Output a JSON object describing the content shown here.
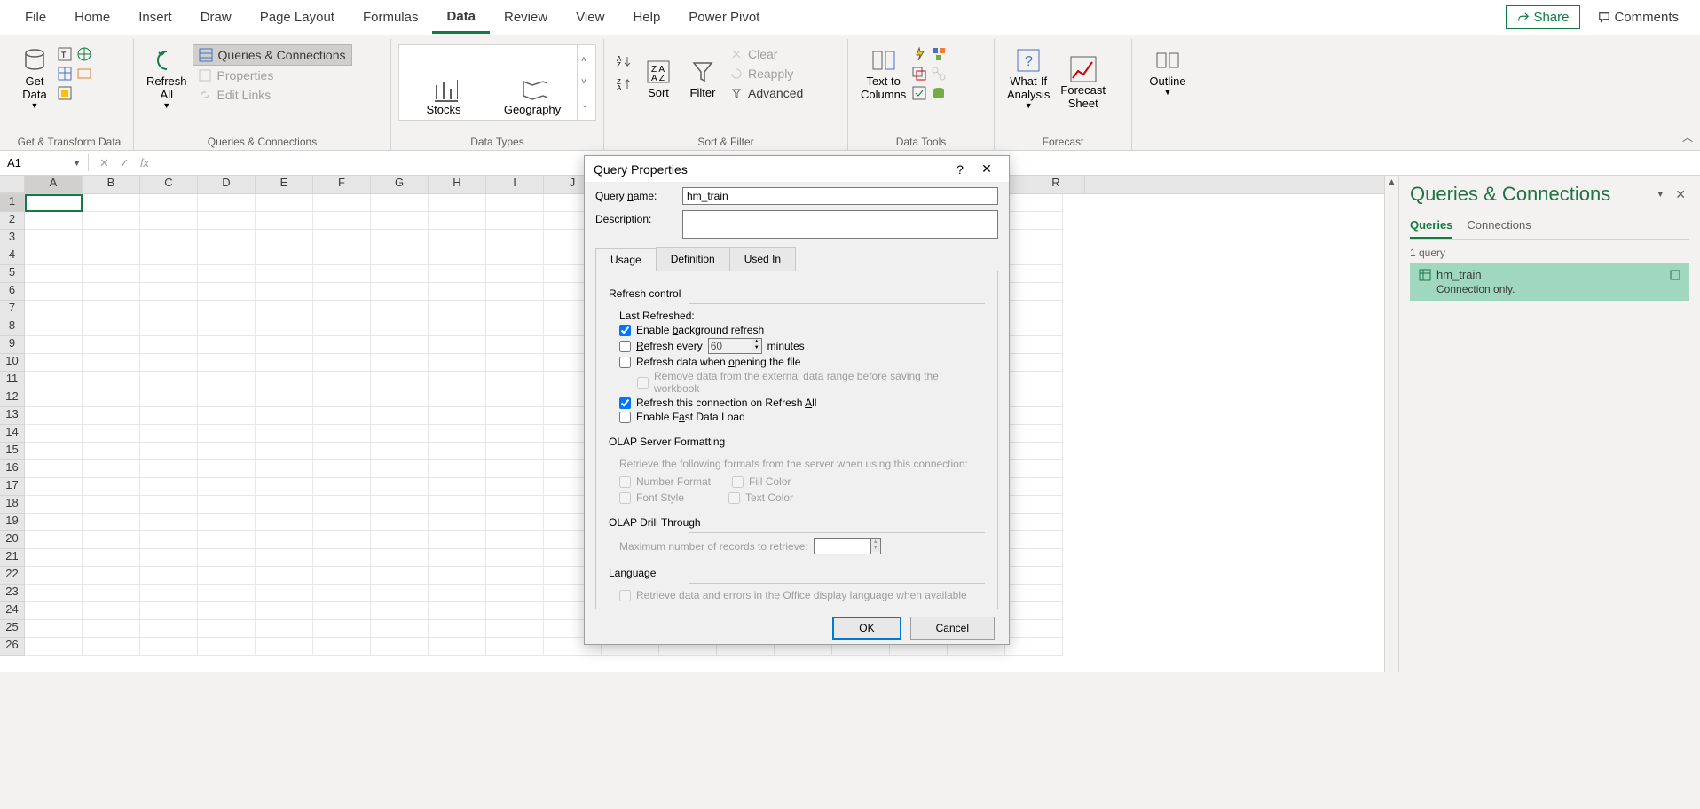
{
  "tabs": {
    "file": "File",
    "home": "Home",
    "insert": "Insert",
    "draw": "Draw",
    "page_layout": "Page Layout",
    "formulas": "Formulas",
    "data": "Data",
    "review": "Review",
    "view": "View",
    "help": "Help",
    "power_pivot": "Power Pivot",
    "share": "Share",
    "comments": "Comments"
  },
  "ribbon": {
    "get_data": "Get\nData",
    "refresh_all": "Refresh\nAll",
    "queries_connections": "Queries & Connections",
    "properties": "Properties",
    "edit_links": "Edit Links",
    "stocks": "Stocks",
    "geography": "Geography",
    "sort": "Sort",
    "filter": "Filter",
    "clear": "Clear",
    "reapply": "Reapply",
    "advanced": "Advanced",
    "text_to_columns": "Text to\nColumns",
    "whatif": "What-If\nAnalysis",
    "forecast_sheet": "Forecast\nSheet",
    "outline": "Outline",
    "groups": {
      "g1": "Get & Transform Data",
      "g2": "Queries & Connections",
      "g3": "Data Types",
      "g4": "Sort & Filter",
      "g5": "Data Tools",
      "g6": "Forecast"
    }
  },
  "name_box": "A1",
  "columns": [
    "A",
    "B",
    "C",
    "D",
    "E",
    "F",
    "G",
    "H",
    "I",
    "J",
    "R"
  ],
  "rows": [
    "1",
    "2",
    "3",
    "4",
    "5",
    "6",
    "7",
    "8",
    "9",
    "10",
    "11",
    "12",
    "13",
    "14",
    "15",
    "16",
    "17",
    "18",
    "19",
    "20",
    "21",
    "22",
    "23",
    "24",
    "25",
    "26"
  ],
  "dialog": {
    "title": "Query Properties",
    "query_name_label": "Query name:",
    "query_name_value": "hm_train",
    "description_label": "Description:",
    "tabs": {
      "usage": "Usage",
      "definition": "Definition",
      "used_in": "Used In"
    },
    "refresh_control": "Refresh control",
    "last_refreshed": "Last Refreshed:",
    "enable_bg": "Enable background refresh",
    "refresh_every": "Refresh every",
    "refresh_minutes_value": "60",
    "minutes": "minutes",
    "refresh_open": "Refresh data when opening the file",
    "remove_data": "Remove data from the external data range before saving the workbook",
    "refresh_all": "Refresh this connection on Refresh All",
    "fast_load": "Enable Fast Data Load",
    "olap_formatting": "OLAP Server Formatting",
    "olap_desc": "Retrieve the following formats from the server when using this connection:",
    "number_format": "Number Format",
    "fill_color": "Fill Color",
    "font_style": "Font Style",
    "text_color": "Text Color",
    "olap_drill": "OLAP Drill Through",
    "max_records": "Maximum number of records to retrieve:",
    "language": "Language",
    "retrieve_lang": "Retrieve data and errors in the Office display language when available",
    "ok": "OK",
    "cancel": "Cancel"
  },
  "panel": {
    "title": "Queries & Connections",
    "tab_queries": "Queries",
    "tab_connections": "Connections",
    "count": "1 query",
    "item_name": "hm_train",
    "item_desc": "Connection only."
  }
}
